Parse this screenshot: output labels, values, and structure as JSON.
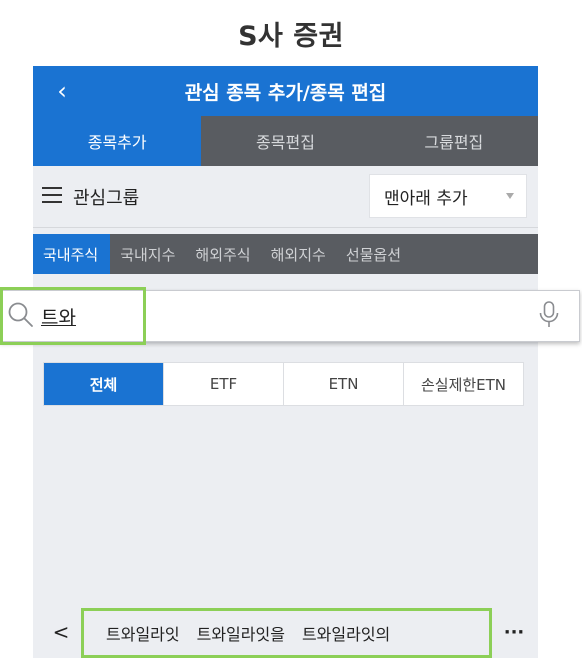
{
  "caption": "S사 증권",
  "header": {
    "back_icon": "‹",
    "title": "관심 종목 추가/종목 편집"
  },
  "top_tabs": [
    {
      "label": "종목추가",
      "active": true
    },
    {
      "label": "종목편집",
      "active": false
    },
    {
      "label": "그룹편집",
      "active": false
    }
  ],
  "group": {
    "label": "관심그룹",
    "dropdown_value": "맨아래 추가"
  },
  "market_tabs": [
    {
      "label": "국내주식",
      "active": true
    },
    {
      "label": "국내지수",
      "active": false
    },
    {
      "label": "해외주식",
      "active": false
    },
    {
      "label": "해외지수",
      "active": false
    },
    {
      "label": "선물옵션",
      "active": false
    }
  ],
  "search": {
    "value": "트와",
    "placeholder": ""
  },
  "filter_chips": [
    {
      "label": "전체",
      "active": true
    },
    {
      "label": "ETF",
      "active": false
    },
    {
      "label": "ETN",
      "active": false
    },
    {
      "label": "손실제한ETN",
      "active": false
    }
  ],
  "suggestions": {
    "back_icon": "<",
    "items": [
      "트와일라잇",
      "트와일라잇을",
      "트와일라잇의"
    ],
    "more_icon": "···"
  },
  "colors": {
    "primary": "#1a73d2",
    "tab_dark": "#595c61",
    "background": "#eceef2",
    "highlight": "#8ccf57"
  }
}
